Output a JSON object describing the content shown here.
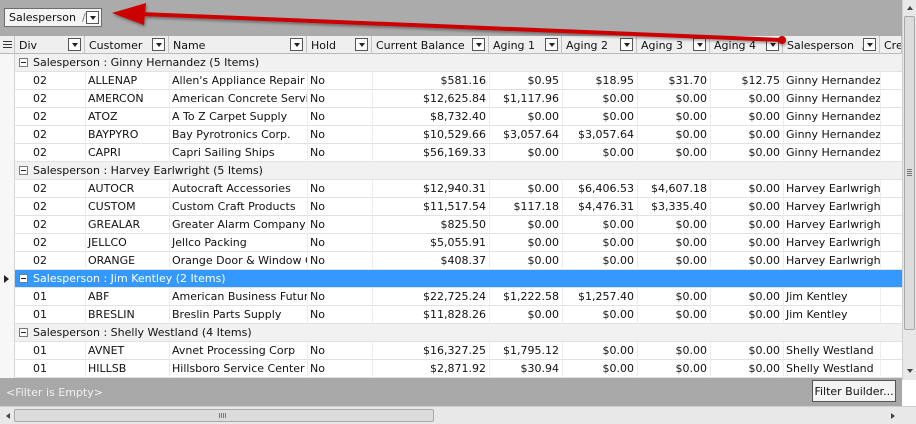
{
  "group_panel": {
    "chip_label": "Salesperson",
    "chip_sort": "/"
  },
  "columns": [
    {
      "key": "div",
      "label": "Div",
      "align": "left"
    },
    {
      "key": "customer",
      "label": "Customer",
      "align": "left"
    },
    {
      "key": "name",
      "label": "Name",
      "align": "left"
    },
    {
      "key": "hold",
      "label": "Hold",
      "align": "left"
    },
    {
      "key": "balance",
      "label": "Current Balance",
      "align": "right"
    },
    {
      "key": "aging1",
      "label": "Aging 1",
      "align": "right"
    },
    {
      "key": "aging2",
      "label": "Aging 2",
      "align": "right"
    },
    {
      "key": "aging3",
      "label": "Aging 3",
      "align": "right"
    },
    {
      "key": "aging4",
      "label": "Aging 4",
      "align": "right"
    },
    {
      "key": "salesperson",
      "label": "Salesperson",
      "align": "left",
      "sort": "/"
    },
    {
      "key": "cre",
      "label": "Cre",
      "align": "left"
    }
  ],
  "groups": [
    {
      "label": "Salesperson : Ginny Hernandez (5 Items)",
      "selected": false,
      "rows": [
        {
          "div": "02",
          "customer": "ALLENAP",
          "name": "Allen's Appliance Repair",
          "hold": "No",
          "balance": "$581.16",
          "aging1": "$0.95",
          "aging2": "$18.95",
          "aging3": "$31.70",
          "aging4": "$12.75",
          "salesperson": "Ginny Hernandez"
        },
        {
          "div": "02",
          "customer": "AMERCON",
          "name": "American Concrete Service",
          "hold": "No",
          "balance": "$12,625.84",
          "aging1": "$1,117.96",
          "aging2": "$0.00",
          "aging3": "$0.00",
          "aging4": "$0.00",
          "salesperson": "Ginny Hernandez"
        },
        {
          "div": "02",
          "customer": "ATOZ",
          "name": "A To Z Carpet Supply",
          "hold": "No",
          "balance": "$8,732.40",
          "aging1": "$0.00",
          "aging2": "$0.00",
          "aging3": "$0.00",
          "aging4": "$0.00",
          "salesperson": "Ginny Hernandez"
        },
        {
          "div": "02",
          "customer": "BAYPYRO",
          "name": "Bay Pyrotronics Corp.",
          "hold": "No",
          "balance": "$10,529.66",
          "aging1": "$3,057.64",
          "aging2": "$3,057.64",
          "aging3": "$0.00",
          "aging4": "$0.00",
          "salesperson": "Ginny Hernandez"
        },
        {
          "div": "02",
          "customer": "CAPRI",
          "name": "Capri Sailing Ships",
          "hold": "No",
          "balance": "$56,169.33",
          "aging1": "$0.00",
          "aging2": "$0.00",
          "aging3": "$0.00",
          "aging4": "$0.00",
          "salesperson": "Ginny Hernandez"
        }
      ]
    },
    {
      "label": "Salesperson : Harvey Earlwright (5 Items)",
      "selected": false,
      "rows": [
        {
          "div": "02",
          "customer": "AUTOCR",
          "name": "Autocraft Accessories",
          "hold": "No",
          "balance": "$12,940.31",
          "aging1": "$0.00",
          "aging2": "$6,406.53",
          "aging3": "$4,607.18",
          "aging4": "$0.00",
          "salesperson": "Harvey Earlwright"
        },
        {
          "div": "02",
          "customer": "CUSTOM",
          "name": "Custom Craft Products",
          "hold": "No",
          "balance": "$11,517.54",
          "aging1": "$117.18",
          "aging2": "$4,476.31",
          "aging3": "$3,335.40",
          "aging4": "$0.00",
          "salesperson": "Harvey Earlwright"
        },
        {
          "div": "02",
          "customer": "GREALAR",
          "name": "Greater Alarm Company",
          "hold": "No",
          "balance": "$825.50",
          "aging1": "$0.00",
          "aging2": "$0.00",
          "aging3": "$0.00",
          "aging4": "$0.00",
          "salesperson": "Harvey Earlwright"
        },
        {
          "div": "02",
          "customer": "JELLCO",
          "name": "Jellco Packing",
          "hold": "No",
          "balance": "$5,055.91",
          "aging1": "$0.00",
          "aging2": "$0.00",
          "aging3": "$0.00",
          "aging4": "$0.00",
          "salesperson": "Harvey Earlwright"
        },
        {
          "div": "02",
          "customer": "ORANGE",
          "name": "Orange Door & Window Co.",
          "hold": "No",
          "balance": "$408.37",
          "aging1": "$0.00",
          "aging2": "$0.00",
          "aging3": "$0.00",
          "aging4": "$0.00",
          "salesperson": "Harvey Earlwright"
        }
      ]
    },
    {
      "label": "Salesperson : Jim Kentley (2 Items)",
      "selected": true,
      "rows": [
        {
          "div": "01",
          "customer": "ABF",
          "name": "American Business Futures",
          "hold": "No",
          "balance": "$22,725.24",
          "aging1": "$1,222.58",
          "aging2": "$1,257.40",
          "aging3": "$0.00",
          "aging4": "$0.00",
          "salesperson": "Jim Kentley"
        },
        {
          "div": "01",
          "customer": "BRESLIN",
          "name": "Breslin Parts Supply",
          "hold": "No",
          "balance": "$11,828.26",
          "aging1": "$0.00",
          "aging2": "$0.00",
          "aging3": "$0.00",
          "aging4": "$0.00",
          "salesperson": "Jim Kentley"
        }
      ]
    },
    {
      "label": "Salesperson : Shelly Westland (4 Items)",
      "selected": false,
      "rows": [
        {
          "div": "01",
          "customer": "AVNET",
          "name": "Avnet Processing Corp",
          "hold": "No",
          "balance": "$16,327.25",
          "aging1": "$1,795.12",
          "aging2": "$0.00",
          "aging3": "$0.00",
          "aging4": "$0.00",
          "salesperson": "Shelly Westland"
        },
        {
          "div": "01",
          "customer": "HILLSB",
          "name": "Hillsboro Service Center",
          "hold": "No",
          "balance": "$2,871.92",
          "aging1": "$30.94",
          "aging2": "$0.00",
          "aging3": "$0.00",
          "aging4": "$0.00",
          "salesperson": "Shelly Westland"
        }
      ]
    }
  ],
  "filter_bar": {
    "status_text": "<Filter is Empty>",
    "builder_label": "Filter Builder..."
  },
  "colors": {
    "selection": "#3399ff",
    "annotation_arrow": "#cc0000",
    "panel_gray": "#ababab"
  }
}
